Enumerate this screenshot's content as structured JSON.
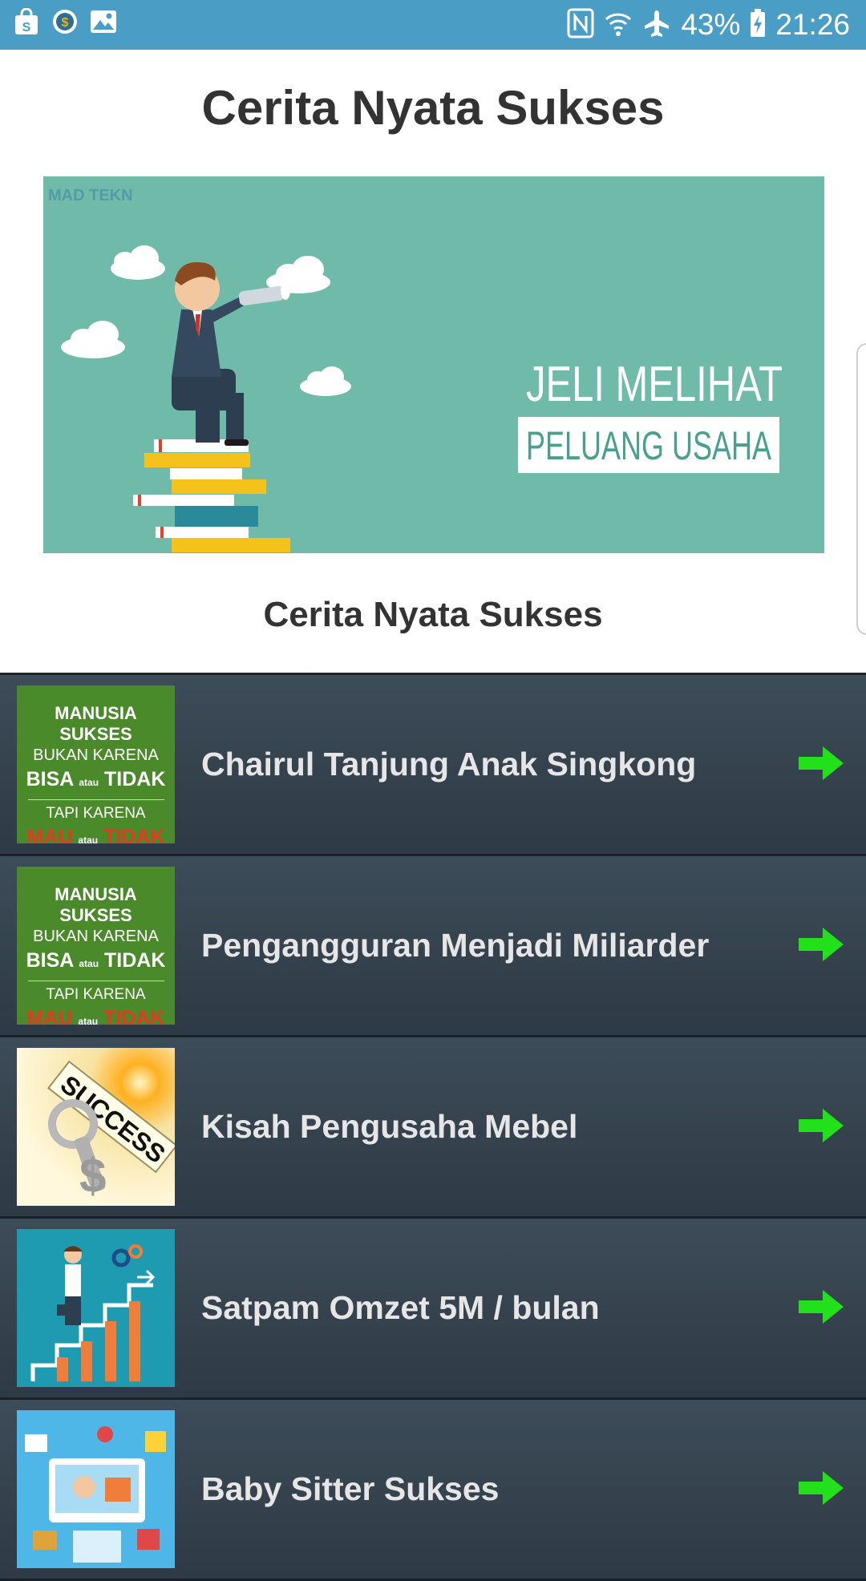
{
  "status_bar": {
    "battery": "43%",
    "time": "21:26",
    "left_icons": [
      "shopping-bag-icon",
      "coin-icon",
      "image-icon"
    ],
    "right_icons": [
      "nfc-icon",
      "wifi-icon",
      "airplane-icon",
      "battery-charging-icon"
    ]
  },
  "app": {
    "title": "Cerita Nyata Sukses"
  },
  "banner": {
    "text_line1": "JELI MELIHAT",
    "text_line2": "PELUANG USAHA",
    "watermark": "MAD TEKN",
    "caption": "Cerita Nyata Sukses"
  },
  "thumb_text": {
    "line1": "MANUSIA SUKSES",
    "line2": "BUKAN KARENA",
    "bisa": "BISA",
    "atau": "atau",
    "tidak": "TIDAK",
    "line4": "TAPI KARENA",
    "mau": "MAU",
    "success": "SUCCESS"
  },
  "list": {
    "items": [
      {
        "label": "Chairul Tanjung Anak Singkong",
        "thumb": "motivation-green"
      },
      {
        "label": "Pengangguran Menjadi Miliarder",
        "thumb": "motivation-green"
      },
      {
        "label": "Kisah Pengusaha Mebel",
        "thumb": "success-key"
      },
      {
        "label": "Satpam Omzet 5M / bulan",
        "thumb": "career-stairs"
      },
      {
        "label": "Baby Sitter Sukses",
        "thumb": "online-shop"
      }
    ]
  },
  "colors": {
    "status_bar": "#4a9dc4",
    "banner_bg": "#6fbaa9",
    "row_bg": "#3d4c59",
    "arrow": "#22e01a"
  }
}
